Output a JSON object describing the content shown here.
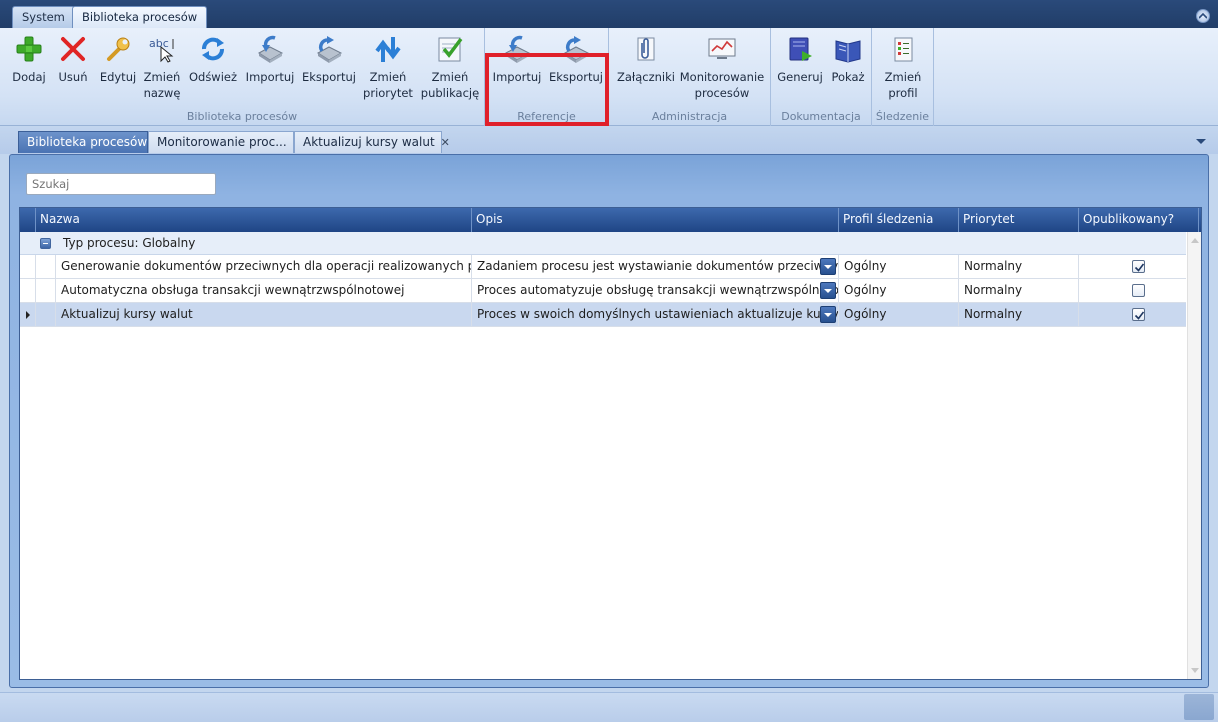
{
  "app_tabs": [
    {
      "label": "System"
    },
    {
      "label": "Biblioteka procesów"
    }
  ],
  "ribbon": {
    "groups": [
      {
        "label": "Biblioteka procesów",
        "buttons": [
          {
            "label": "Dodaj",
            "icon": "plus-icon"
          },
          {
            "label": "Usuń",
            "icon": "delete-x-icon"
          },
          {
            "label": "Edytuj",
            "icon": "wrench-icon"
          },
          {
            "label": "Zmień\nnazwę",
            "icon": "rename-abc-icon"
          },
          {
            "label": "Odśwież",
            "icon": "refresh-icon"
          },
          {
            "label": "Importuj",
            "icon": "import-icon"
          },
          {
            "label": "Eksportuj",
            "icon": "export-icon"
          },
          {
            "label": "Zmień\npriorytet",
            "icon": "priority-arrows-icon"
          },
          {
            "label": "Zmień\npublikację",
            "icon": "publish-check-icon"
          }
        ]
      },
      {
        "label": "Referencje",
        "buttons": [
          {
            "label": "Importuj",
            "icon": "import-icon"
          },
          {
            "label": "Eksportuj",
            "icon": "export-icon"
          }
        ]
      },
      {
        "label": "Administracja",
        "buttons": [
          {
            "label": "Załączniki",
            "icon": "attachment-icon"
          },
          {
            "label": "Monitorowanie\nprocesów",
            "icon": "monitor-chart-icon"
          }
        ]
      },
      {
        "label": "Dokumentacja",
        "buttons": [
          {
            "label": "Generuj",
            "icon": "generate-book-icon"
          },
          {
            "label": "Pokaż",
            "icon": "open-book-icon"
          }
        ]
      },
      {
        "label": "Śledzenie",
        "buttons": [
          {
            "label": "Zmień\nprofil",
            "icon": "profile-list-icon"
          }
        ]
      }
    ]
  },
  "doc_tabs": [
    {
      "label": "Biblioteka procesów",
      "closable": false
    },
    {
      "label": "Monitorowanie proc...",
      "closable": true
    },
    {
      "label": "Aktualizuj kursy walut",
      "closable": true
    }
  ],
  "search": {
    "placeholder": "Szukaj"
  },
  "grid": {
    "columns": [
      "Nazwa",
      "Opis",
      "Profil śledzenia",
      "Priorytet",
      "Opublikowany?"
    ],
    "group_label": "Typ procesu: Globalny",
    "rows": [
      {
        "name": "Generowanie dokumentów przeciwnych dla operacji realizowanych pom...",
        "description": "Zadaniem procesu jest wystawianie dokumentów przeciwnych w",
        "profile": "Ogólny",
        "priority": "Normalny",
        "published": true,
        "selected": false
      },
      {
        "name": "Automatyczna obsługa transakcji wewnątrzwspólnotowej",
        "description": "Proces automatyzuje obsługę transakcji wewnątrzwspólnotowycl",
        "profile": "Ogólny",
        "priority": "Normalny",
        "published": false,
        "selected": false
      },
      {
        "name": "Aktualizuj kursy walut",
        "description": "Proces w swoich domyślnych ustawieniach aktualizuje kursy walu",
        "profile": "Ogólny",
        "priority": "Normalny",
        "published": true,
        "selected": true
      }
    ]
  }
}
